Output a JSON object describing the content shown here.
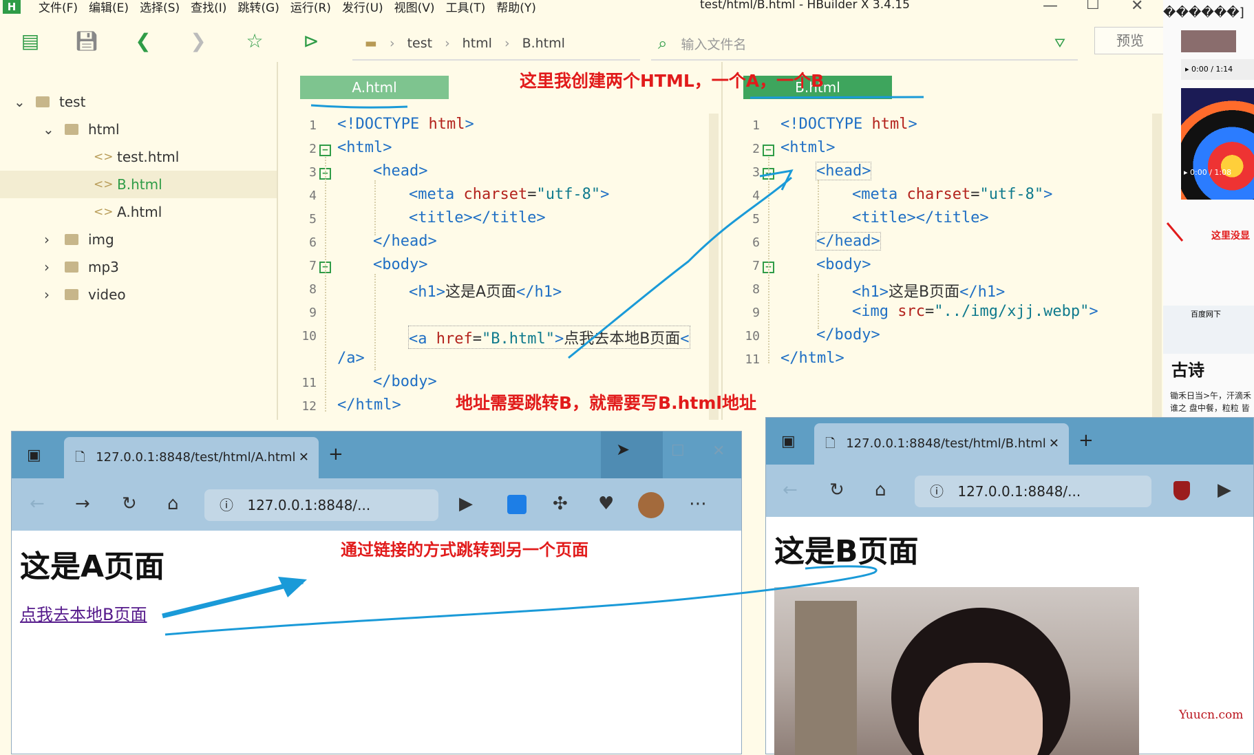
{
  "titlebar": {
    "menu": [
      "文件(F)",
      "编辑(E)",
      "选择(S)",
      "查找(I)",
      "跳转(G)",
      "运行(R)",
      "发行(U)",
      "视图(V)",
      "工具(T)",
      "帮助(Y)"
    ],
    "title": "test/html/B.html - HBuilder X 3.4.15"
  },
  "toolbar": {
    "breadcrumb": [
      "test",
      "html",
      "B.html"
    ],
    "file_search_placeholder": "输入文件名",
    "preview_label": "预览"
  },
  "sidebar": {
    "items": [
      {
        "label": "test",
        "type": "folder",
        "expanded": true,
        "depth": 0
      },
      {
        "label": "html",
        "type": "folder",
        "expanded": true,
        "depth": 1
      },
      {
        "label": "test.html",
        "type": "file",
        "depth": 2
      },
      {
        "label": "B.html",
        "type": "file",
        "depth": 2,
        "active": true
      },
      {
        "label": "A.html",
        "type": "file",
        "depth": 2
      },
      {
        "label": "img",
        "type": "folder",
        "expanded": false,
        "depth": 1
      },
      {
        "label": "mp3",
        "type": "folder",
        "expanded": false,
        "depth": 1
      },
      {
        "label": "video",
        "type": "folder",
        "expanded": false,
        "depth": 1
      }
    ]
  },
  "editorA": {
    "tab": "A.html",
    "line_numbers": [
      "1",
      "2",
      "3",
      "4",
      "5",
      "6",
      "7",
      "8",
      "9",
      "10",
      "",
      "11",
      "12"
    ]
  },
  "editorB": {
    "tab": "B.html",
    "line_numbers": [
      "1",
      "2",
      "3",
      "4",
      "5",
      "6",
      "7",
      "8",
      "9",
      "10",
      "11"
    ]
  },
  "annotations": {
    "top": "这里我创建两个HTML，一个A，一个B",
    "middle": "地址需要跳转B，就需要写B.html地址",
    "browser": "通过链接的方式跳转到另一个页面"
  },
  "browserA": {
    "tab_title": "127.0.0.1:8848/test/html/A.html",
    "address": "127.0.0.1:8848/...",
    "heading": "这是A页面",
    "link": "点我去本地B页面"
  },
  "browserB": {
    "tab_title": "127.0.0.1:8848/test/html/B.html",
    "address": "127.0.0.1:8848/...",
    "heading": "这是B页面"
  },
  "right_panel": {
    "garbled_text": "������]",
    "video_time_1": "0:00 / 1:14",
    "video_time_2": "0:00 / 1:08",
    "red_note": "这里没显",
    "mini_tab": "百度网下",
    "poem_title": "古诗",
    "poem_line1": "锄禾日当>午，汗滴禾",
    "poem_line2": "谁之 盘中餐，粒粒 皆",
    "watermark": "Yuucn.com"
  },
  "colors": {
    "accent_green": "#2f9c47",
    "tab_active": "#3ea55d",
    "tab_inactive": "#7ec48f",
    "annotation_red": "#e11b1b",
    "pen_blue": "#1a9ad8",
    "browser_frame": "#5f9ec4"
  }
}
